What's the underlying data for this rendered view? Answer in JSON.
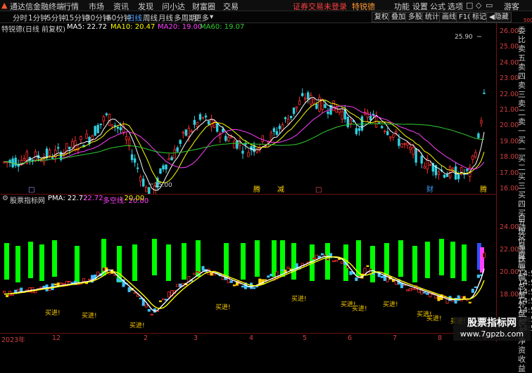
{
  "titlebar": {
    "app_title": "通达信金融终端",
    "login_status": "证券交易未登录",
    "stock_name": "特锐德",
    "guest": "游客"
  },
  "menu": [
    "行情",
    "市场",
    "资讯",
    "发现",
    "问小达",
    "财富圈",
    "交易"
  ],
  "top_right_menu": [
    "功能",
    "设置",
    "公式",
    "选项"
  ],
  "periods": [
    "分时",
    "1分钟",
    "5分钟",
    "15分钟",
    "30分钟",
    "60分钟",
    "日线",
    "周线",
    "月线",
    "多周期",
    "更多"
  ],
  "active_period": "日线",
  "tools": [
    "复权",
    "叠加",
    "多股",
    "统计",
    "画线",
    "F10",
    "标记",
    "◀隐藏"
  ],
  "main_chart": {
    "title": "特锐德(日线 前复权)",
    "ma": [
      {
        "label": "MA5: 22.72",
        "color": "#ffffff"
      },
      {
        "label": "MA10: 20.47",
        "color": "#ffff00"
      },
      {
        "label": "MA20: 19.00",
        "color": "#ff40ff"
      },
      {
        "label": "MA60: 19.07",
        "color": "#30d030"
      }
    ],
    "high_label": "25.90",
    "low_label": "15.00",
    "y_ticks": [
      "26.00",
      "25.00",
      "24.00",
      "23.00",
      "22.00",
      "21.00",
      "20.00",
      "19.00",
      "18.00",
      "17.00",
      "16.00"
    ],
    "events": [
      {
        "label": "□",
        "color": "#a0a0ff"
      },
      {
        "label": "腾",
        "color": "#ffd000"
      },
      {
        "label": "减",
        "color": "#ffd000"
      },
      {
        "label": "□",
        "color": "#ff5050"
      },
      {
        "label": "财",
        "color": "#40a0ff"
      },
      {
        "label": "腾",
        "color": "#ffd000"
      }
    ]
  },
  "sub_chart": {
    "title": "股票指标网",
    "pma": "PMA: 22.72",
    "v1": "22.72",
    "v2_label": "多空线: 20.00",
    "v3": ": 20.00",
    "buy_labels": [
      "买进!",
      "买进!",
      "买进!",
      "买进!",
      "买进!",
      "买进!",
      "买进!",
      "买进!",
      "买进!",
      "买进!",
      "买进!"
    ],
    "y_ticks": [
      "24.00",
      "22.00",
      "20.00",
      "18.00"
    ]
  },
  "sidebar": {
    "top_value": "500",
    "vert1": [
      "委比",
      "卖五",
      "卖四",
      "卖三",
      "卖二",
      "卖一",
      "买一",
      "买二",
      "买三",
      "买四",
      "买五",
      "现价",
      "涨跌",
      "涨幅",
      "总量",
      "外盘",
      "换手",
      "净资",
      "收益"
    ],
    "vert2": [
      "自动",
      "交易",
      "盘后",
      "14:5",
      "14:5",
      "14:5",
      "14:5",
      "14:5",
      "14:5",
      "14:5"
    ]
  },
  "dates": [
    "2023年",
    "12",
    "2",
    "3",
    "4",
    "5",
    "6",
    "7",
    "8",
    "9"
  ],
  "watermark": {
    "line1": "股票指标网",
    "line2": "www.7gpzb.com"
  }
}
